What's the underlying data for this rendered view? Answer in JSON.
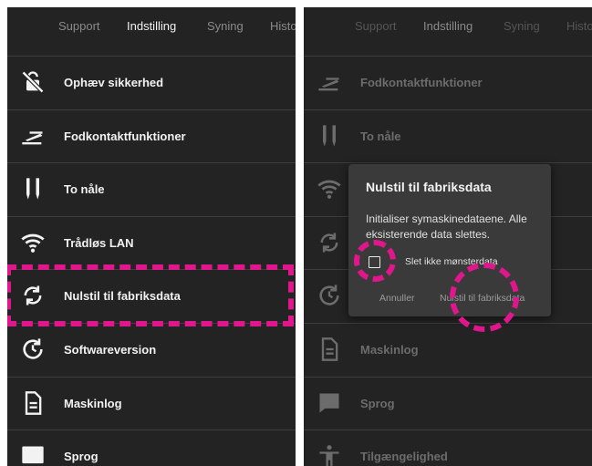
{
  "tabs": [
    {
      "label": "Support",
      "active": false
    },
    {
      "label": "Indstilling",
      "active": true
    },
    {
      "label": "Syning",
      "active": false
    },
    {
      "label": "Histo",
      "active": false
    }
  ],
  "left_menu": [
    {
      "label": "Ophæv sikkerhed",
      "icon": "unlock-off-icon"
    },
    {
      "label": "Fodkontaktfunktioner",
      "icon": "foot-pedal-icon"
    },
    {
      "label": "To nåle",
      "icon": "twin-needle-icon"
    },
    {
      "label": "Trådløs LAN",
      "icon": "wifi-icon"
    },
    {
      "label": "Nulstil til fabriksdata",
      "icon": "reset-icon"
    },
    {
      "label": "Softwareversion",
      "icon": "software-update-icon"
    },
    {
      "label": "Maskinlog",
      "icon": "document-icon"
    },
    {
      "label": "Sprog",
      "icon": "language-icon"
    }
  ],
  "right_menu": [
    {
      "label": "Fodkontaktfunktioner",
      "icon": "foot-pedal-icon"
    },
    {
      "label": "To nåle",
      "icon": "twin-needle-icon"
    },
    {
      "label": "",
      "icon": "wifi-icon"
    },
    {
      "label": "",
      "icon": "reset-icon"
    },
    {
      "label": "",
      "icon": "software-update-icon"
    },
    {
      "label": "Maskinlog",
      "icon": "document-icon"
    },
    {
      "label": "Sprog",
      "icon": "language-icon"
    },
    {
      "label": "Tilgængelighed",
      "icon": "accessibility-icon"
    }
  ],
  "dialog": {
    "title": "Nulstil til fabriksdata",
    "message": "Initialiser symaskinedataene. Alle eksisterende data slettes.",
    "checkbox_label": "Slet ikke mønsterdata",
    "checkbox_checked": false,
    "cancel_label": "Annuller",
    "confirm_label": "Nulstil til fabriksdata"
  },
  "colors": {
    "background": "#232323",
    "dialog": "#3a3a3a",
    "highlight": "#e0168c",
    "text": "#f2f2f2"
  }
}
